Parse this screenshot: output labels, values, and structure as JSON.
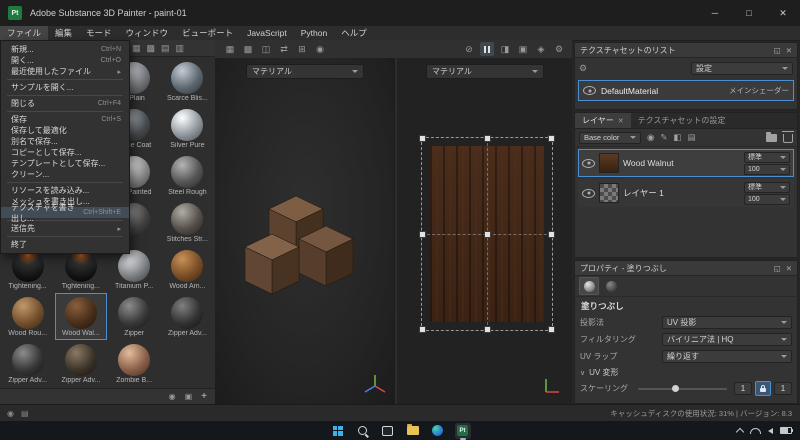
{
  "titlebar": {
    "title": "Adobe Substance 3D Painter - paint-01",
    "app_badge": "Pt"
  },
  "menubar": {
    "items": [
      "ファイル",
      "編集",
      "モード",
      "ウィンドウ",
      "ビューポート",
      "JavaScript",
      "Python",
      "ヘルプ"
    ]
  },
  "file_menu": {
    "items": [
      {
        "label": "新規...",
        "shortcut": "Ctrl+N"
      },
      {
        "label": "開く...",
        "shortcut": "Ctrl+O"
      },
      {
        "label": "最近使用したファイル",
        "shortcut": ""
      },
      {
        "label": "サンプルを開く...",
        "shortcut": ""
      },
      {
        "label": "閉じる",
        "shortcut": "Ctrl+F4"
      },
      {
        "label": "保存",
        "shortcut": "Ctrl+S"
      },
      {
        "label": "保存して最適化",
        "shortcut": ""
      },
      {
        "label": "別名で保存...",
        "shortcut": ""
      },
      {
        "label": "コピーとして保存...",
        "shortcut": ""
      },
      {
        "label": "テンプレートとして保存...",
        "shortcut": ""
      },
      {
        "label": "クリーン...",
        "shortcut": ""
      },
      {
        "label": "リソースを読み込み...",
        "shortcut": ""
      },
      {
        "label": "メッシュを書き出し...",
        "shortcut": ""
      },
      {
        "label": "テクスチャを書き出し...",
        "shortcut": "Ctrl+Shift+E"
      },
      {
        "label": "送信先",
        "shortcut": ""
      },
      {
        "label": "終了",
        "shortcut": ""
      }
    ]
  },
  "shelf": {
    "cells": [
      "",
      "",
      "...Plain",
      "Scarce Blis...",
      "",
      "",
      "...one Coat",
      "Silver Pure",
      "",
      "",
      "...il Painted",
      "Steel Rough",
      "",
      "",
      "",
      "Stitches Str...",
      "Tightening...",
      "Tightening...",
      "Titanium P...",
      "Wood Am...",
      "Wood Rou...",
      "Wood Wal...",
      "Zipper",
      "Zipper Adv...",
      "Zipper Adv...",
      "Zipper Adv...",
      "Zombie B...",
      ""
    ],
    "add_label": "+"
  },
  "viewport": {
    "material_3d": "マテリアル",
    "material_2d": "マテリアル"
  },
  "texture_set_panel": {
    "title": "テクスチャセットのリスト",
    "settings": "設定",
    "material": "DefaultMaterial",
    "shader": "メインシェーダー"
  },
  "layers_panel": {
    "tab_layers": "レイヤー",
    "tab_settings": "テクスチャセットの設定",
    "channel": "Base color",
    "layers": [
      {
        "name": "Wood Walnut",
        "blend": "標準",
        "opacity": "100"
      },
      {
        "name": "レイヤー 1",
        "blend": "標準",
        "opacity": "100"
      }
    ]
  },
  "properties_panel": {
    "title": "プロパティ - 塗りつぶし",
    "section": "塗りつぶし",
    "projection_label": "投影法",
    "projection": "UV 投影",
    "filtering_label": "フィルタリング",
    "filtering": "バイリニア法 | HQ",
    "uvwrap_label": "UV ラップ",
    "uvwrap": "繰り返す",
    "transform_section": "UV 変形",
    "scaling_label": "スケーリング",
    "scale_x": "1",
    "scale_y": "1"
  },
  "statusbar": {
    "text": "キャッシュディスクの使用状況: 31%  |  バージョン: 8.3"
  },
  "colors": {
    "accent": "#4a8fd4",
    "selection": "#414c57"
  }
}
